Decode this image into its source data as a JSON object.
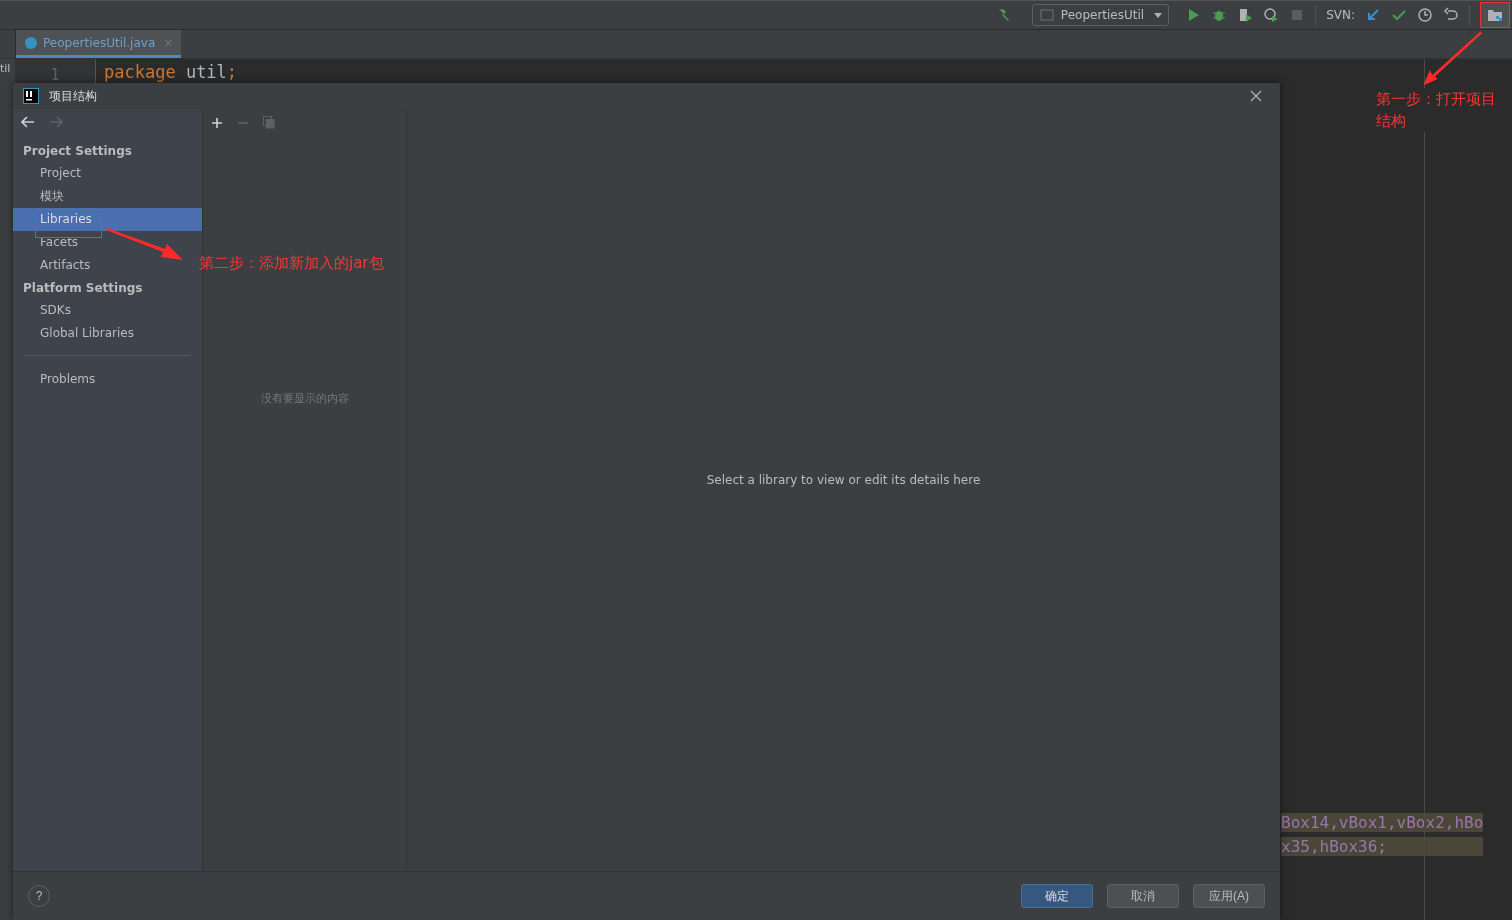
{
  "toolbar": {
    "run_config": "PeopertiesUtil",
    "svn_label": "SVN:"
  },
  "editor": {
    "tab": {
      "label": "PeopertiesUtil.java",
      "selected": true,
      "close": "×"
    },
    "side_text": "til",
    "line_number": "1",
    "code": [
      {
        "kind": "keyword",
        "text": "package"
      },
      {
        "kind": "ident",
        "text": " util"
      },
      {
        "kind": "punct",
        "text": ";"
      }
    ],
    "right_code": [
      "Box14,vBox1,vBox2,hBo",
      "x35,hBox36;"
    ]
  },
  "dialog": {
    "title": "项目结构",
    "sidebar": [
      {
        "kind": "header",
        "label": "Project Settings"
      },
      {
        "kind": "item",
        "label": "Project",
        "selected": false
      },
      {
        "kind": "item",
        "label": "模块",
        "selected": false
      },
      {
        "kind": "item",
        "label": "Libraries",
        "selected": true
      },
      {
        "kind": "item",
        "label": "Facets",
        "selected": false
      },
      {
        "kind": "item",
        "label": "Artifacts",
        "selected": false
      },
      {
        "kind": "header",
        "label": "Platform Settings"
      },
      {
        "kind": "item",
        "label": "SDKs",
        "selected": false
      },
      {
        "kind": "item",
        "label": "Global Libraries",
        "selected": false
      },
      {
        "kind": "separator"
      },
      {
        "kind": "item",
        "label": "Problems",
        "selected": false
      }
    ],
    "empty_list": "没有要显示的内容",
    "details_hint": "Select a library to view or edit its details here",
    "help": "?",
    "buttons": [
      {
        "label": "确定",
        "primary": true
      },
      {
        "label": "取消",
        "primary": false
      },
      {
        "label": "应用(A)",
        "primary": false
      }
    ]
  },
  "annotations": [
    {
      "text": "第一步：打开项目结构"
    },
    {
      "text": "第二步：添加新加入的jar包"
    }
  ]
}
